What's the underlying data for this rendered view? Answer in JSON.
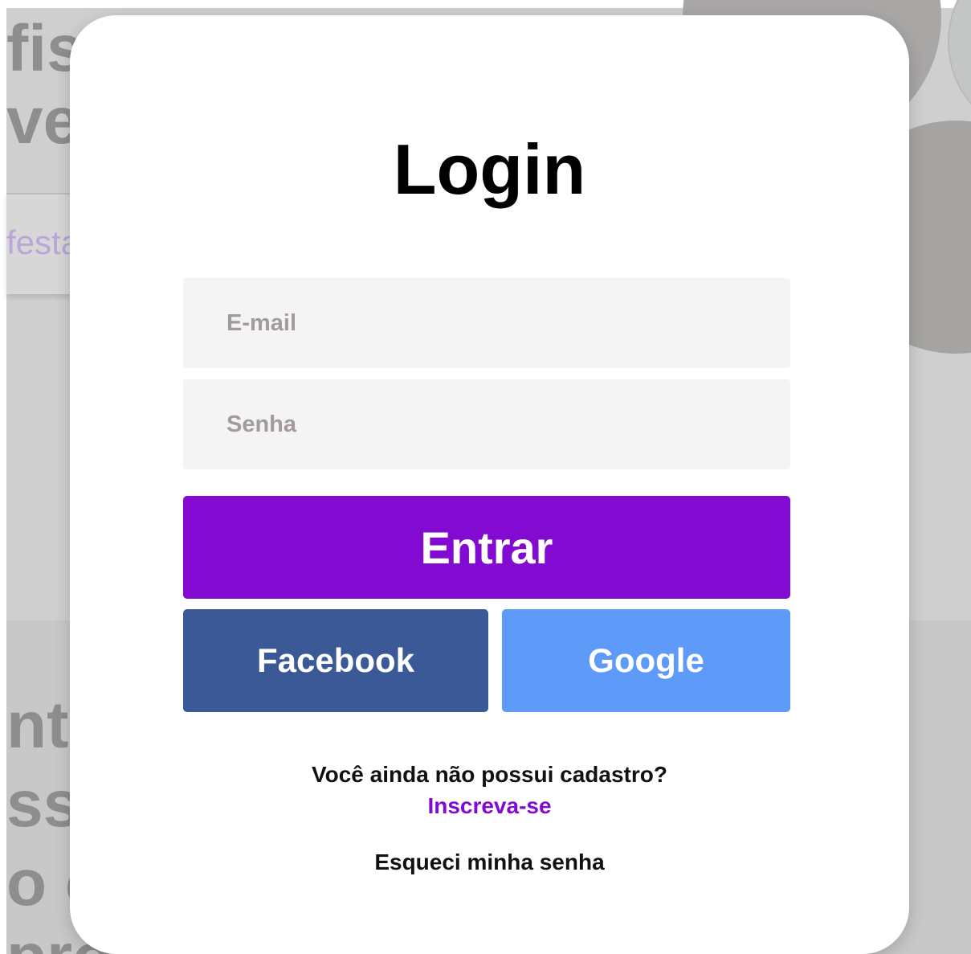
{
  "background": {
    "heading_lines": [
      "fiss",
      "ver"
    ],
    "search_placeholder": "festa",
    "section_lines": [
      "nte",
      "ss",
      "o c",
      "pro"
    ]
  },
  "modal": {
    "title": "Login",
    "email_placeholder": "E-mail",
    "password_placeholder": "Senha",
    "enter_label": "Entrar",
    "facebook_label": "Facebook",
    "google_label": "Google",
    "signup_question": "Você ainda não possui cadastro?",
    "signup_link": "Inscreva-se",
    "forgot_password": "Esqueci minha senha"
  },
  "colors": {
    "primary": "#820ad1",
    "facebook": "#3b5997",
    "google": "#5e9af8",
    "input_background": "#f4f4f4",
    "overlay": "#cfcfcf"
  }
}
